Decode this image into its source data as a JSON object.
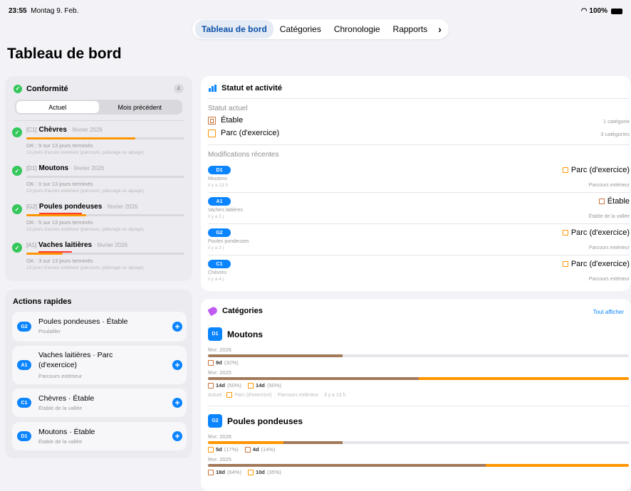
{
  "status_bar": {
    "time": "23:55",
    "date": "Montag 9. Feb.",
    "battery": "100%"
  },
  "tabs": [
    {
      "label": "Tableau de bord",
      "active": true
    },
    {
      "label": "Catégories"
    },
    {
      "label": "Chronologie"
    },
    {
      "label": "Rapports"
    }
  ],
  "page_title": "Tableau de bord",
  "conformite": {
    "title": "Conformité",
    "count": "4",
    "segments": [
      "Actuel",
      "Mois précédent"
    ],
    "items": [
      {
        "code": "[C1]",
        "name": "Chèvres",
        "date": "· février 2026",
        "progress": 0.69,
        "status": "OK : 9 sur 13 jours terminés",
        "desc": "13 jours d'accès extérieur (parcours, pâturage ou alpage)"
      },
      {
        "code": "[D1]",
        "name": "Moutons",
        "date": "· février 2026",
        "progress": 0.0,
        "status": "OK : 0 sur 13 jours terminés",
        "desc": "13 jours d'accès extérieur (parcours, pâturage ou alpage)"
      },
      {
        "code": "[G2]",
        "name": "Poules pondeuses",
        "date": "· février 2026",
        "progress": 0.38,
        "status": "OK : 5 sur 13 jours terminés",
        "desc": "13 jours d'accès extérieur (parcours, pâturage ou alpage)"
      },
      {
        "code": "[A1]",
        "name": "Vaches laitières",
        "date": "· février 2026",
        "progress": 0.23,
        "status": "OK : 3 sur 13 jours terminés",
        "desc": "13 jours d'accès extérieur (parcours, pâturage ou alpage)"
      }
    ]
  },
  "actions": {
    "title": "Actions rapides",
    "items": [
      {
        "code": "G2",
        "line1": "Poules pondeuses · Étable",
        "line2": "",
        "sub": "Poulailler"
      },
      {
        "code": "A1",
        "line1": "Vaches laitières · Parc",
        "line2": "(d'exercice)",
        "sub": "Parcours extérieur"
      },
      {
        "code": "C1",
        "line1": "Chèvres · Étable",
        "line2": "",
        "sub": "Étable de la vallée"
      },
      {
        "code": "D1",
        "line1": "Moutons · Étable",
        "line2": "",
        "sub": "Étable de la vallée"
      }
    ]
  },
  "statut": {
    "title": "Statut et activité",
    "current_label": "Statut actuel",
    "current": [
      {
        "label": "Étable",
        "count": "1 catégorie",
        "icon": "barn-icon"
      },
      {
        "label": "Parc (d'exercice)",
        "count": "3 catégories",
        "icon": "park-icon"
      }
    ],
    "recent_label": "Modifications récentes",
    "recent": [
      {
        "code": "D1",
        "name": "Moutons",
        "ago": "il y a 13 h",
        "dest": "Parc (d'exercice)",
        "dest_sub": "Parcours extérieur",
        "icon": "park-icon"
      },
      {
        "code": "A1",
        "name": "Vaches laitières",
        "ago": "il y a 3 j",
        "dest": "Étable",
        "dest_sub": "Étable de la vallée",
        "icon": "barn-icon"
      },
      {
        "code": "G2",
        "name": "Poules pondeuses",
        "ago": "il y a 3 j",
        "dest": "Parc (d'exercice)",
        "dest_sub": "Parcours extérieur",
        "icon": "park-icon"
      },
      {
        "code": "C1",
        "name": "Chèvres",
        "ago": "il y a 4 j",
        "dest": "Parc (d'exercice)",
        "dest_sub": "Parcours extérieur",
        "icon": "park-icon"
      }
    ]
  },
  "categories": {
    "title": "Catégories",
    "link": "Tout afficher",
    "items": [
      {
        "code": "D1",
        "name": "Moutons",
        "periods": [
          {
            "label": "févr. 2026",
            "barn": 0.32,
            "park": 0.0,
            "legend": [
              {
                "icon": "barn",
                "val": "9d",
                "pct": "(32%)"
              }
            ]
          },
          {
            "label": "févr. 2025",
            "barn": 0.5,
            "park": 0.5,
            "legend": [
              {
                "icon": "barn",
                "val": "14d",
                "pct": "(50%)"
              },
              {
                "icon": "park",
                "val": "14d",
                "pct": "(50%)"
              }
            ]
          }
        ],
        "footer": {
          "prefix": "Actuel :",
          "place": "Parc (d'exercice)",
          "sep1": "·",
          "zone": "Parcours extérieur",
          "sep2": "·",
          "ago": "il y a 13 h"
        }
      },
      {
        "code": "G2",
        "name": "Poules pondeuses",
        "periods": [
          {
            "label": "févr. 2026",
            "park": 0.18,
            "barn": 0.14,
            "legend": [
              {
                "icon": "park",
                "val": "5d",
                "pct": "(17%)"
              },
              {
                "icon": "barn",
                "val": "4d",
                "pct": "(14%)"
              }
            ]
          },
          {
            "label": "févr. 2025",
            "barn": 0.66,
            "park": 0.34,
            "legend": [
              {
                "icon": "barn",
                "val": "18d",
                "pct": "(64%)"
              },
              {
                "icon": "park",
                "val": "10d",
                "pct": "(35%)"
              }
            ]
          }
        ]
      }
    ]
  }
}
